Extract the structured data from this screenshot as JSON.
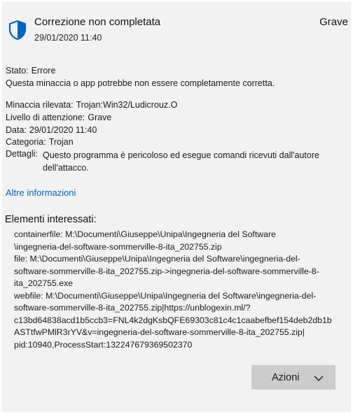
{
  "header": {
    "title": "Correzione non completata",
    "datetime": "29/01/2020 11:40",
    "severity": "Grave",
    "icon": "shield-icon",
    "icon_color": "#0067c0"
  },
  "status": {
    "label": "Stato:",
    "value": "Errore",
    "message": "Questa minaccia o app potrebbe non essere completamente corretta."
  },
  "info": {
    "threat_label": "Minaccia rilevata:",
    "threat_value": "Trojan:Win32/Ludicrouz.O",
    "alert_label": "Livello di attenzione:",
    "alert_value": "Grave",
    "date_label": "Data:",
    "date_value": "29/01/2020 11:40",
    "category_label": "Categoria:",
    "category_value": "Trojan",
    "details_label": "Dettagli:",
    "details_value": "Questo programma è pericoloso ed esegue comandi ricevuti dall'autore dell'attacco."
  },
  "more_info_link": "Altre informazioni",
  "affected": {
    "heading": "Elementi interessati:",
    "items": [
      "containerfile: M:\\Documenti\\Giuseppe\\Unipa\\Ingegneria del Software\n\\ingegneria-del-software-sommerville-8-ita_202755.zip",
      "file: M:\\Documenti\\Giuseppe\\Unipa\\Ingegneria del Software\\ingegneria-del-\nsoftware-sommerville-8-ita_202755.zip->ingegneria-del-software-sommerville-8-\nita_202755.exe",
      "webfile: M:\\Documenti\\Giuseppe\\Unipa\\Ingegneria del Software\\ingegneria-del-\nsoftware-sommerville-8-ita_202755.zip|https://unblogexin.ml/?\nc13bd64838acd1b5ccb3=FNL4k2dgKsbQFE69303c81c4c1caabefbef154deb2db1b\nASTtfwPMlR3rYV&v=ingegneria-del-software-sommerville-8-ita_202755.zip|\npid:10940,ProcessStart:132247679369502370"
    ]
  },
  "actions_button": {
    "label": "Azioni",
    "icon": "chevron-down-icon"
  }
}
